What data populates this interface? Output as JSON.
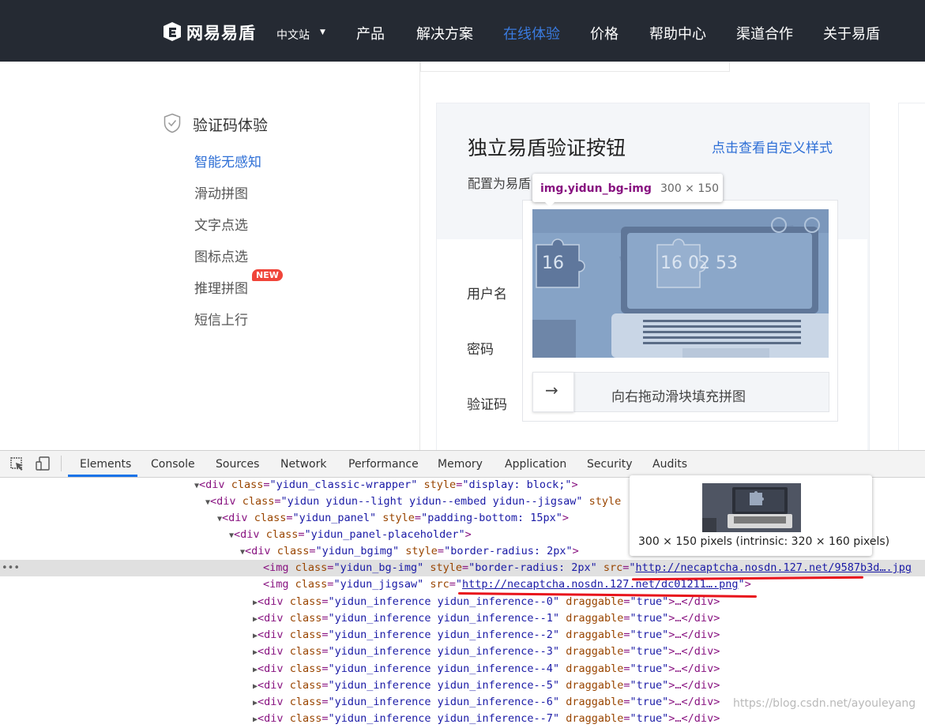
{
  "nav": {
    "logo_text": "网易易盾",
    "lang": "中文站",
    "items": [
      "产品",
      "解决方案",
      "在线体验",
      "价格",
      "帮助中心",
      "渠道合作",
      "关于易盾"
    ],
    "active_index": 2
  },
  "sidebar": {
    "title": "验证码体验",
    "items": [
      "智能无感知",
      "滑动拼图",
      "文字点选",
      "图标点选",
      "推理拼图",
      "短信上行"
    ],
    "active_index": 0,
    "badge": "NEW"
  },
  "card": {
    "title": "独立易盾验证按钮",
    "link": "点击查看自定义样式",
    "desc": "配置为易盾",
    "labels": [
      "用户名",
      "密码",
      "验证码"
    ]
  },
  "captcha": {
    "image_text_left": "16",
    "image_text_right": "16 02 53",
    "slider_arrow": "→",
    "slider_text": "向右拖动滑块填充拼图"
  },
  "tooltip": {
    "selector": "img.yidun_bg-img",
    "size": "300 × 150"
  },
  "devtools": {
    "tabs": [
      "Elements",
      "Console",
      "Sources",
      "Network",
      "Performance",
      "Memory",
      "Application",
      "Security",
      "Audits"
    ],
    "active_tab": "Elements",
    "preview_caption": "300 × 150 pixels (intrinsic: 320 × 160 pixels)",
    "ellipsis": "•••",
    "lines": {
      "l0_tag": "<div",
      "l0_attr1": "class",
      "l0_val1": "\"yidun_classic-wrapper\"",
      "l0_attr2": "style",
      "l0_val2": "\"display: block;\"",
      "l0_end": ">",
      "l1_tag": "<div",
      "l1_attr1": "class",
      "l1_val1": "\"yidun yidun--light yidun--embed yidun--jigsaw\"",
      "l1_attr2": "style",
      "l2_tag": "<div",
      "l2_attr1": "class",
      "l2_val1": "\"yidun_panel\"",
      "l2_attr2": "style",
      "l2_val2": "\"padding-bottom: 15px\"",
      "l2_end": ">",
      "l3_tag": "<div",
      "l3_attr1": "class",
      "l3_val1": "\"yidun_panel-placeholder\"",
      "l3_end": ">",
      "l4_tag": "<div",
      "l4_attr1": "class",
      "l4_val1": "\"yidun_bgimg\"",
      "l4_attr2": "style",
      "l4_val2": "\"border-radius: 2px\"",
      "l4_end": ">",
      "l5_tag": "<img",
      "l5_attr1": "class",
      "l5_val1": "\"yidun_bg-img\"",
      "l5_attr2": "style",
      "l5_val2": "\"border-radius: 2px\"",
      "l5_attr3": "src",
      "l5_link": "http://necaptcha.nosdn.127.net/9587b3d….jpg",
      "l6_tag": "<img",
      "l6_attr1": "class",
      "l6_val1": "\"yidun_jigsaw\"",
      "l6_attr2": "src",
      "l6_link": "http://necaptcha.nosdn.127.net/dc01211….png",
      "l6_end": ">",
      "inference": [
        "\"yidun_inference yidun_inference--0\"",
        "\"yidun_inference yidun_inference--1\"",
        "\"yidun_inference yidun_inference--2\"",
        "\"yidun_inference yidun_inference--3\"",
        "\"yidun_inference yidun_inference--4\"",
        "\"yidun_inference yidun_inference--5\"",
        "\"yidun_inference yidun_inference--6\"",
        "\"yidun_inference yidun_inference--7\""
      ],
      "inf_tag": "<div",
      "inf_attr1": "class",
      "inf_attr2": "draggable",
      "inf_val2": "\"true\"",
      "inf_close": ">…</div>"
    }
  },
  "watermark": "https://blog.csdn.net/ayouleyang"
}
